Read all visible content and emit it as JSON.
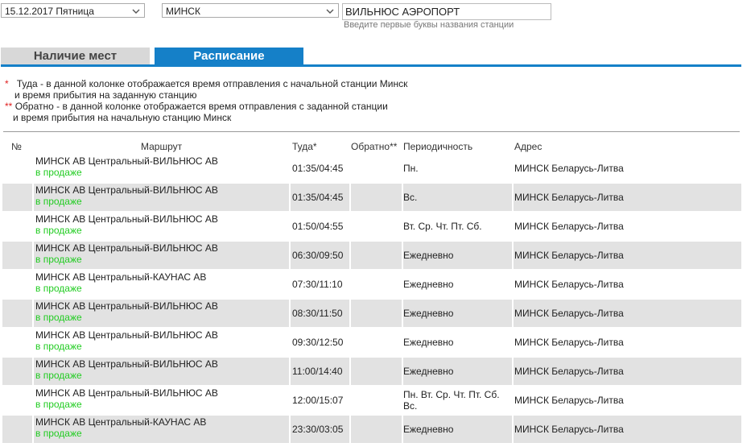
{
  "search": {
    "date_value": "15.12.2017 Пятница",
    "from_value": "МИНСК",
    "to_value": "ВИЛЬНЮС АЭРОПОРТ",
    "hint": "Введите первые буквы названия станции"
  },
  "tabs": {
    "availability": "Наличие мест",
    "schedule": "Расписание"
  },
  "notes": {
    "star1": "*",
    "line1a": "Туда - в данной колонке отображается время отправления с начальной станции Минск",
    "line1b": "и время прибытия на заданную станцию",
    "star2": "**",
    "line2a": "Обратно - в данной колонке отображается время отправления с заданной станции",
    "line2b": "и время прибытия на начальную станцию Минск"
  },
  "table": {
    "headers": {
      "num": "№",
      "route": "Маршрут",
      "there": "Туда*",
      "back": "Обратно**",
      "period": "Периодичность",
      "address": "Адрес"
    },
    "rows": [
      {
        "route": "МИНСК АВ Центральный-ВИЛЬНЮС АВ",
        "status": "в продаже",
        "there": "01:35/04:45",
        "back": "",
        "period": "Пн.",
        "address": "МИНСК Беларусь-Литва"
      },
      {
        "route": "МИНСК АВ Центральный-ВИЛЬНЮС АВ",
        "status": "в продаже",
        "there": "01:35/04:45",
        "back": "",
        "period": "Вс.",
        "address": "МИНСК Беларусь-Литва"
      },
      {
        "route": "МИНСК АВ Центральный-ВИЛЬНЮС АВ",
        "status": "в продаже",
        "there": "01:50/04:55",
        "back": "",
        "period": "Вт. Ср. Чт. Пт. Сб.",
        "address": "МИНСК Беларусь-Литва"
      },
      {
        "route": "МИНСК АВ Центральный-ВИЛЬНЮС АВ",
        "status": "в продаже",
        "there": "06:30/09:50",
        "back": "",
        "period": "Ежедневно",
        "address": "МИНСК Беларусь-Литва"
      },
      {
        "route": "МИНСК АВ Центральный-КАУНАС АВ",
        "status": "в продаже",
        "there": "07:30/11:10",
        "back": "",
        "period": "Ежедневно",
        "address": "МИНСК Беларусь-Литва"
      },
      {
        "route": "МИНСК АВ Центральный-ВИЛЬНЮС АВ",
        "status": "в продаже",
        "there": "08:30/11:50",
        "back": "",
        "period": "Ежедневно",
        "address": "МИНСК Беларусь-Литва"
      },
      {
        "route": "МИНСК АВ Центральный-ВИЛЬНЮС АВ",
        "status": "в продаже",
        "there": "09:30/12:50",
        "back": "",
        "period": "Ежедневно",
        "address": "МИНСК Беларусь-Литва"
      },
      {
        "route": "МИНСК АВ Центральный-ВИЛЬНЮС АВ",
        "status": "в продаже",
        "there": "11:00/14:40",
        "back": "",
        "period": "Ежедневно",
        "address": "МИНСК Беларусь-Литва"
      },
      {
        "route": "МИНСК АВ Центральный-ВИЛЬНЮС АВ",
        "status": "в продаже",
        "there": "12:00/15:07",
        "back": "",
        "period": "Пн. Вт. Ср. Чт. Пт. Сб. Вс.",
        "address": "МИНСК Беларусь-Литва"
      },
      {
        "route": "МИНСК АВ Центральный-КАУНАС АВ",
        "status": "в продаже",
        "there": "23:30/03:05",
        "back": "",
        "period": "Ежедневно",
        "address": "МИНСК Беларусь-Литва"
      }
    ]
  },
  "colors": {
    "accent": "#1580c8",
    "status_green": "#22cc22",
    "row_alt": "#e2e2e2",
    "note_star": "#e02020"
  },
  "icons": {
    "dropdown": "chevron-down-icon"
  }
}
